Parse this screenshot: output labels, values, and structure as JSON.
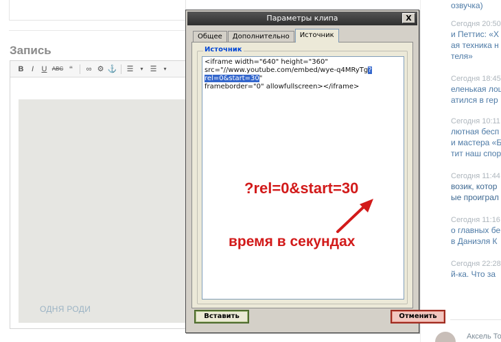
{
  "editor": {
    "title": "Запись",
    "toolbar": [
      "B",
      "I",
      "U",
      "ABC",
      "“",
      "∞",
      "⚙",
      "⚓",
      "☰",
      "☰"
    ]
  },
  "dialog": {
    "title": "Параметры клипа",
    "close_label": "X",
    "tabs": [
      {
        "label": "Общее",
        "active": false
      },
      {
        "label": "Дополнительно",
        "active": false
      },
      {
        "label": "Источник",
        "active": true
      }
    ],
    "legend": "Источник",
    "source_before": "<iframe width=\"640\" height=\"360\"\nsrc=\"//www.youtube.com/embed/wye-q4MRyTg",
    "source_selected": "?rel=0&start=30",
    "source_after": "\"\nframeborder=\"0\" allowfullscreen></iframe>",
    "insert_label": "Вставить",
    "cancel_label": "Отменить"
  },
  "annotation": {
    "param": "?rel=0&start=30",
    "note": "время в секундах",
    "color": "#d21a1a"
  },
  "sidebar": {
    "entries": [
      {
        "time": "",
        "text": "озвучка)"
      },
      {
        "time": "Сегодня 20:50",
        "text": "и Петтис: «Х"
      },
      {
        "time": "",
        "text": "ая техника н"
      },
      {
        "time": "",
        "text": "теля»"
      },
      {
        "time": "Сегодня 18:45",
        "text": "еленькая лош"
      },
      {
        "time": "",
        "text": "атился в гер"
      },
      {
        "time": "Сегодня 10:11",
        "text": "лютная бесп"
      },
      {
        "time": "",
        "text": "и мастера «Б"
      },
      {
        "time": "",
        "text": "тит наш спор"
      },
      {
        "time": "Сегодня 11:44",
        "text": "возик, котор"
      },
      {
        "time": "",
        "text": "ые проиграл"
      },
      {
        "time": "Сегодня 11:16",
        "text": "о главных бе"
      },
      {
        "time": "",
        "text": "в Даниэля К"
      },
      {
        "time": "Сегодня 22:28",
        "text": "й-ка. Что за"
      }
    ],
    "section": "ОДНЯ РОДИ",
    "user": "Аксель То"
  }
}
